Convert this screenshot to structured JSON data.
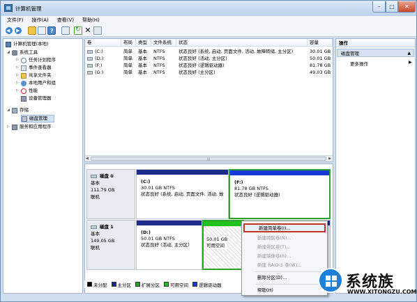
{
  "window": {
    "title": "计算机管理"
  },
  "menubar": {
    "items": [
      "文件(F)",
      "操作(A)",
      "查看(V)",
      "帮助(H)"
    ]
  },
  "tree": {
    "root": "计算机管理(本地)",
    "system_tools": "系统工具",
    "task_scheduler": "任务计划程序",
    "event_viewer": "事件查看器",
    "shared_folders": "共享文件夹",
    "local_users": "本地用户和组",
    "performance": "性能",
    "device_manager": "设备管理器",
    "storage": "存储",
    "disk_management": "磁盘管理",
    "services": "服务和应用程序"
  },
  "volumes": {
    "headers": [
      "卷",
      "布局",
      "类型",
      "文件系统",
      "状态",
      "容量"
    ],
    "rows": [
      {
        "vol": "(C:)",
        "layout": "简单",
        "type": "基本",
        "fs": "NTFS",
        "status": "状态良好 (系统, 启动, 页面文件, 活动, 故障转储, 主分区)",
        "cap": "30.01 GB"
      },
      {
        "vol": "(D:)",
        "layout": "简单",
        "type": "基本",
        "fs": "NTFS",
        "status": "状态良好 (活动, 主分区)",
        "cap": "50.01 GB"
      },
      {
        "vol": "(F:)",
        "layout": "简单",
        "type": "基本",
        "fs": "NTFS",
        "status": "状态良好 (逻辑驱动器)",
        "cap": "81.78 GB"
      },
      {
        "vol": "(G:)",
        "layout": "简单",
        "type": "基本",
        "fs": "NTFS",
        "status": "状态良好 (主分区)",
        "cap": "49.03 GB"
      }
    ]
  },
  "disks": {
    "disk0": {
      "name": "磁盘 0",
      "type": "基本",
      "size": "111.79 GB",
      "state": "联机",
      "c": {
        "name": "(C:)",
        "size": "30.01 GB NTFS",
        "status": "状态良好 (系统, 启动, 页面文件, 活动, 故"
      },
      "f": {
        "name": "(F:)",
        "size": "81.78 GB NTFS",
        "status": "状态良好 (逻辑驱动器)"
      }
    },
    "disk1": {
      "name": "磁盘 1",
      "type": "基本",
      "size": "149.05 GB",
      "state": "联机",
      "d": {
        "name": "(D:)",
        "size": "50.01 GB NTFS",
        "status": "状态良好 (活动, 主分区)"
      },
      "free": {
        "size": "50.01 GB",
        "status": "可用空间"
      }
    }
  },
  "legend": [
    "未分配",
    "主分区",
    "扩展分区",
    "可用空间",
    "逻辑驱动器"
  ],
  "legend_colors": [
    "#000000",
    "#1d2a8c",
    "#2ca12b",
    "#22c01c",
    "#1a3ad6"
  ],
  "actions": {
    "title": "操作",
    "section": "磁盘管理",
    "more": "更多操作"
  },
  "context_menu": {
    "new_simple": "新建简单卷(I)...",
    "new_spanned": "新建跨区卷(N)...",
    "new_striped": "新建带区卷(T)...",
    "new_mirror": "新建镜像卷(R)...",
    "new_raid5": "新建 RAID-5 卷(W)...",
    "delete_partition": "删除分区(D)...",
    "help": "帮助(H)"
  },
  "watermark": {
    "text": "系统族",
    "sub": "WWW.XITONGZU.COM"
  }
}
